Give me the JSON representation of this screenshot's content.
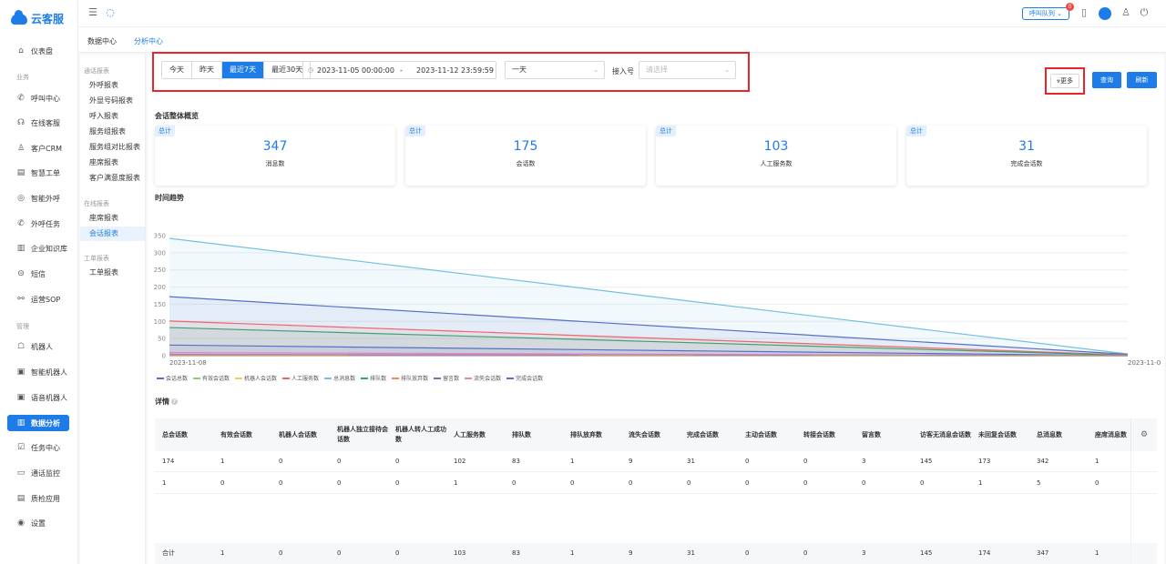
{
  "app": {
    "logo_text": "云客服"
  },
  "sidebar": {
    "sections": [
      "业务",
      "管理"
    ],
    "items": [
      {
        "label": "仪表盘",
        "icon": "home-icon",
        "glyph": "⌂"
      },
      {
        "label": "呼叫中心",
        "icon": "phone-icon",
        "glyph": "✆"
      },
      {
        "label": "在线客服",
        "icon": "headset-icon",
        "glyph": "☊"
      },
      {
        "label": "客户CRM",
        "icon": "user-icon",
        "glyph": "♙"
      },
      {
        "label": "智慧工单",
        "icon": "ticket-icon",
        "glyph": "▤"
      },
      {
        "label": "智能外呼",
        "icon": "outbound-icon",
        "glyph": "◎"
      },
      {
        "label": "外呼任务",
        "icon": "task-phone-icon",
        "glyph": "✆"
      },
      {
        "label": "企业知识库",
        "icon": "book-icon",
        "glyph": "▥"
      },
      {
        "label": "短信",
        "icon": "sms-icon",
        "glyph": "⊝"
      },
      {
        "label": "运营SOP",
        "icon": "flow-icon",
        "glyph": "⚯"
      },
      {
        "label": "机器人",
        "icon": "robot-icon",
        "glyph": "☖"
      },
      {
        "label": "智能机器人",
        "icon": "smart-robot-icon",
        "glyph": "▣"
      },
      {
        "label": "语音机器人",
        "icon": "voice-robot-icon",
        "glyph": "▣"
      },
      {
        "label": "数据分析",
        "icon": "chart-icon",
        "glyph": "▥"
      },
      {
        "label": "任务中心",
        "icon": "checklist-icon",
        "glyph": "☑"
      },
      {
        "label": "通话监控",
        "icon": "monitor-icon",
        "glyph": "▭"
      },
      {
        "label": "质检应用",
        "icon": "quality-icon",
        "glyph": "▤"
      },
      {
        "label": "设置",
        "icon": "settings-icon",
        "glyph": "◉"
      }
    ]
  },
  "topbar": {
    "queue_label": "呼叫队列",
    "queue_badge": "0",
    "menu_icon": "☰",
    "chat_icon": "◌",
    "doc_icon": "▯",
    "user_icon": "♙",
    "power_icon": "⏻"
  },
  "subtabs": [
    "数据中心",
    "分析中心"
  ],
  "reports": {
    "groups": [
      "通话报表",
      "在线报表",
      "工单报表"
    ],
    "call_items": [
      "外呼报表",
      "外显号码报表",
      "呼入报表",
      "服务组报表",
      "服务组对比报表",
      "座席报表",
      "客户满意度报表"
    ],
    "online_items": [
      "座席报表",
      "会话报表"
    ],
    "ticket_items": [
      "工单报表"
    ]
  },
  "filters": {
    "quick": [
      "今天",
      "昨天",
      "最近7天",
      "最近30天"
    ],
    "date_start": "2023-11-05 00:00:00",
    "date_sep": "-",
    "date_end": "2023-11-12 23:59:59",
    "granularity": "一天",
    "line_label": "接入号",
    "line_placeholder": "请选择",
    "more": "更多",
    "query": "查询",
    "refresh": "刷新"
  },
  "overview": {
    "title": "会话整体概览",
    "cards": [
      {
        "tag": "总计",
        "value": "347",
        "label": "消息数"
      },
      {
        "tag": "总计",
        "value": "175",
        "label": "会话数"
      },
      {
        "tag": "总计",
        "value": "103",
        "label": "人工服务数"
      },
      {
        "tag": "总计",
        "value": "31",
        "label": "完成会话数"
      }
    ]
  },
  "chart_data": {
    "type": "area",
    "title": "时间趋势",
    "x": [
      "2023-11-08",
      "2023-11-0"
    ],
    "ylim": [
      0,
      350
    ],
    "yticks": [
      0,
      50,
      100,
      150,
      200,
      250,
      300,
      350
    ],
    "grid": true,
    "legend_position": "bottom",
    "series": [
      {
        "name": "会话总数",
        "color": "#5470c6",
        "values": [
          172,
          4
        ]
      },
      {
        "name": "有效会话数",
        "color": "#91cc75",
        "values": [
          1,
          0
        ]
      },
      {
        "name": "机器人会话数",
        "color": "#fac858",
        "values": [
          0,
          0
        ]
      },
      {
        "name": "人工服务数",
        "color": "#ee6666",
        "values": [
          101,
          2
        ]
      },
      {
        "name": "总消息数",
        "color": "#73c0de",
        "values": [
          342,
          5
        ]
      },
      {
        "name": "排队数",
        "color": "#3ba272",
        "values": [
          82,
          1
        ]
      },
      {
        "name": "排队放弃数",
        "color": "#fc8452",
        "values": [
          1,
          0
        ]
      },
      {
        "name": "留言数",
        "color": "#9a60b4",
        "values": [
          3,
          0
        ]
      },
      {
        "name": "流失会话数",
        "color": "#ea7ccc",
        "values": [
          9,
          0
        ]
      },
      {
        "name": "完成会话数",
        "color": "#5470c6",
        "values": [
          31,
          0
        ]
      }
    ]
  },
  "detail": {
    "title": "详情",
    "info_icon": "?",
    "settings_icon": "⚙",
    "columns": [
      "总会话数",
      "有效会话数",
      "机器人会话数",
      "机器人独立接待会话数",
      "机器人转人工成功数",
      "人工服务数",
      "排队数",
      "排队放弃数",
      "流失会话数",
      "完成会话数",
      "主动会话数",
      "转接会话数",
      "留言数",
      "访客无消息会话数",
      "未回复会话数",
      "总消息数",
      "座席消息数"
    ],
    "rows": [
      [
        "174",
        "1",
        "0",
        "0",
        "0",
        "102",
        "83",
        "1",
        "9",
        "31",
        "0",
        "0",
        "3",
        "145",
        "173",
        "342",
        "1"
      ],
      [
        "1",
        "0",
        "0",
        "0",
        "0",
        "1",
        "0",
        "0",
        "0",
        "0",
        "0",
        "0",
        "0",
        "0",
        "1",
        "5",
        "0"
      ]
    ],
    "total": [
      "合计",
      "1",
      "0",
      "0",
      "0",
      "103",
      "83",
      "1",
      "9",
      "31",
      "0",
      "0",
      "3",
      "145",
      "174",
      "347",
      "1"
    ]
  }
}
